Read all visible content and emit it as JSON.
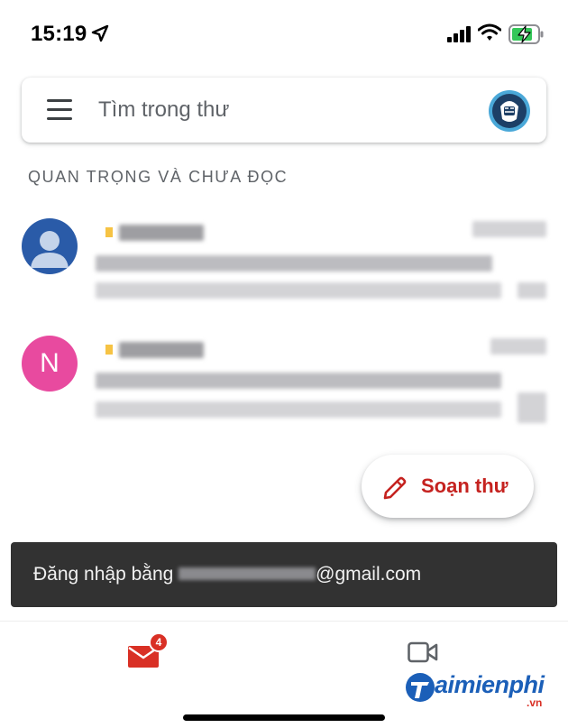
{
  "status_bar": {
    "time": "15:19",
    "icons": [
      "location-arrow-icon",
      "cellular-signal-icon",
      "wifi-icon",
      "battery-charging-icon"
    ]
  },
  "search": {
    "placeholder": "Tìm trong thư",
    "menu_icon": "hamburger-menu-icon",
    "account_avatar": "profile-avatar"
  },
  "section": {
    "title": "QUAN TRỌNG VÀ CHƯA ĐỌC"
  },
  "emails": [
    {
      "avatar_type": "person-icon",
      "avatar_color": "#2a5ba8",
      "sender": "",
      "date": "",
      "subject": "",
      "snippet": "",
      "important": true
    },
    {
      "avatar_type": "letter",
      "avatar_letter": "N",
      "avatar_color": "#e84a9f",
      "sender": "",
      "date": "",
      "subject": "",
      "snippet": "",
      "important": true
    }
  ],
  "compose": {
    "label": "Soạn thư",
    "icon": "pencil-icon",
    "color": "#c5221f"
  },
  "snackbar": {
    "prefix": "Đăng nhập bằng ",
    "suffix": "@gmail.com"
  },
  "bottom_nav": {
    "mail_icon": "mail-icon",
    "mail_badge": "4",
    "meet_icon": "video-camera-icon"
  },
  "watermark": {
    "text": "aimienphi",
    "domain": ".vn"
  },
  "colors": {
    "accent_red": "#d93025",
    "importance": "#f6c344",
    "snackbar_bg": "#323232"
  }
}
